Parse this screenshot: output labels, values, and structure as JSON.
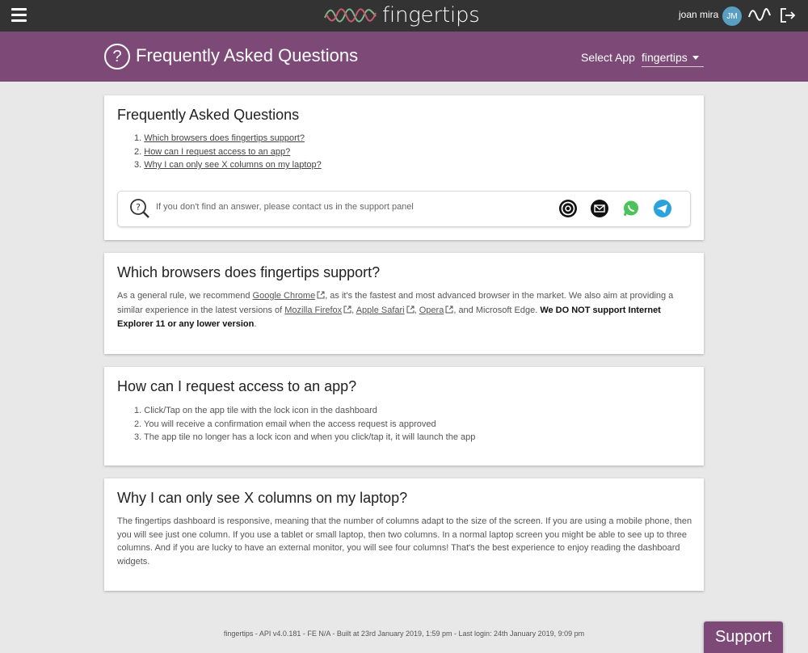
{
  "topbar": {
    "logo_text": "fingertips",
    "user_name": "joan mira",
    "avatar_initials": "JM",
    "colors": {
      "bar": "#333333",
      "avatar": "#5a9fc1"
    }
  },
  "header": {
    "title": "Frequently Asked Questions",
    "select_label": "Select App",
    "select_value": "fingertips",
    "colors": {
      "accent": "#7d4a78"
    }
  },
  "faq": {
    "heading": "Frequently Asked Questions",
    "toc": [
      {
        "num": "1.",
        "label": "Which browsers does fingertips support?"
      },
      {
        "num": "2.",
        "label": "How can I request access to an app?"
      },
      {
        "num": "3.",
        "label": "Why I can only see X columns on my laptop?"
      }
    ],
    "contact_text": "If you don't find an answer, please contact us in the support panel",
    "contact_icons": [
      "workplace-icon",
      "email-icon",
      "whatsapp-icon",
      "telegram-icon"
    ]
  },
  "browsers": {
    "heading": "Which browsers does fingertips support?",
    "t1": "As a general rule, we recommend ",
    "link_chrome": "Google Chrome",
    "t2": ", as it's the fastest and most advanced browser in the market. We also aim at providing a similar experience in the latest versions of ",
    "link_firefox": "Mozilla Firefox",
    "t3": ", ",
    "link_safari": "Apple Safari",
    "t4": ", ",
    "link_opera": "Opera",
    "t5": ", and Microsoft Edge. ",
    "bold": "We DO NOT support Internet Explorer 11 or any lower version",
    "t6": "."
  },
  "access": {
    "heading": "How can I request access to an app?",
    "steps": [
      {
        "num": "1.",
        "text": "Click/Tap on the app tile with the lock icon in the dashboard"
      },
      {
        "num": "2.",
        "text": "You will receive a confirmation email when the access request is approved"
      },
      {
        "num": "3.",
        "text": "The app tile no longer has a lock icon and when you click/tap it, it will launch the app"
      }
    ]
  },
  "columns": {
    "heading": "Why I can only see X columns on my laptop?",
    "text": "The fingertips dashboard is responsive, meaning that the number of columns adapt to the size of the screen. If you are using a mobile phone, then you will see just one column. If you use a tablet or small laptop, then two columns. In a normal laptop screen you might be able to see up to three columns. And if you are lucky to have an external monitor, you will see four columns! That's the best experience to enjoy reading the dashboard widgets."
  },
  "footer": {
    "text": "fingertips - API v4.0.181 - FE N/A - Built at 23rd January 2019, 1:59 pm - Last login: 24th January 2019, 9:09 pm"
  },
  "support": {
    "label": "Support"
  }
}
